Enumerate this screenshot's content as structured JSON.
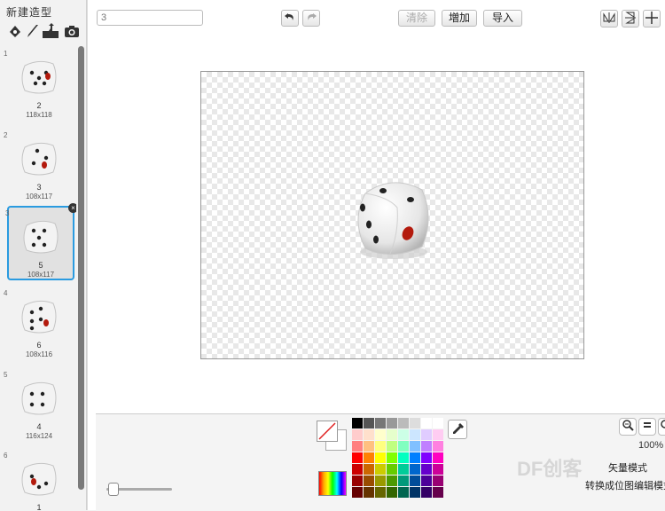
{
  "left_panel": {
    "title": "新建造型",
    "tools": [
      "paint-brush-icon",
      "brush-icon",
      "upload-icon",
      "camera-icon"
    ],
    "costumes": [
      {
        "index": "1",
        "name": "2",
        "size": "118x118",
        "selected": false
      },
      {
        "index": "2",
        "name": "3",
        "size": "108x117",
        "selected": false
      },
      {
        "index": "3",
        "name": "5",
        "size": "108x117",
        "selected": true
      },
      {
        "index": "4",
        "name": "6",
        "size": "108x116",
        "selected": false
      },
      {
        "index": "5",
        "name": "4",
        "size": "116x124",
        "selected": false
      },
      {
        "index": "6",
        "name": "1",
        "size": "",
        "selected": false
      }
    ]
  },
  "editor": {
    "costume_name_value": "3",
    "clear_label": "清除",
    "add_label": "増加",
    "import_label": "导入"
  },
  "bottom": {
    "zoom_percent": "100%",
    "convert_text_a": "矢量模式",
    "convert_text_b": "转换成位图编辑模式",
    "watermark": "DF创客",
    "palette_colors": [
      "#000000",
      "#555555",
      "#777777",
      "#999999",
      "#bbbbbb",
      "#dddddd",
      "#ffffff",
      "#ffffff",
      "#ffcccc",
      "#ffe0cc",
      "#ffffcc",
      "#e6ffcc",
      "#ccffe6",
      "#cce6ff",
      "#e0ccff",
      "#ffccf2",
      "#ff8080",
      "#ffc080",
      "#ffff80",
      "#c0ff80",
      "#80ffc0",
      "#80c0ff",
      "#c080ff",
      "#ff80e0",
      "#ff0000",
      "#ff8000",
      "#ffff00",
      "#80ff00",
      "#00ffc0",
      "#0080ff",
      "#8000ff",
      "#ff00c0",
      "#cc0000",
      "#cc6600",
      "#cccc00",
      "#66cc00",
      "#00cc99",
      "#0066cc",
      "#6600cc",
      "#cc0099",
      "#990000",
      "#994c00",
      "#999900",
      "#4c9900",
      "#00997a",
      "#004c99",
      "#4c0099",
      "#990073",
      "#660000",
      "#663300",
      "#666600",
      "#336600",
      "#006650",
      "#003366",
      "#330066",
      "#66004c"
    ]
  },
  "colors": {
    "selection": "#2a9be0",
    "accent": "#2a9be0"
  }
}
